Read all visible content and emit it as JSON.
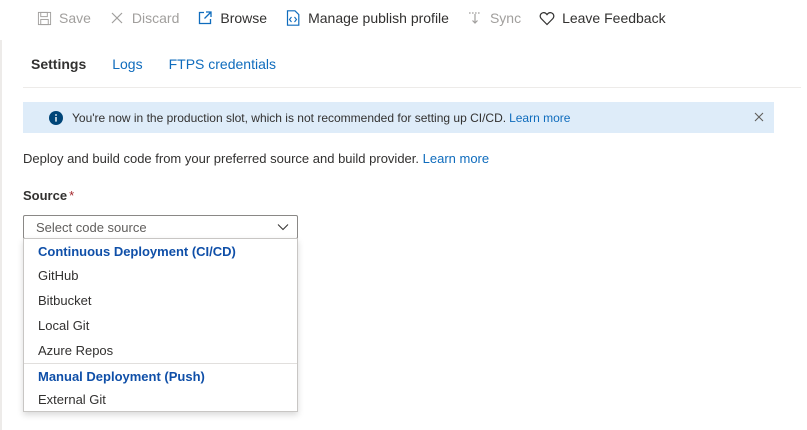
{
  "toolbar": {
    "save": "Save",
    "discard": "Discard",
    "browse": "Browse",
    "manage_publish_profile": "Manage publish profile",
    "sync": "Sync",
    "leave_feedback": "Leave Feedback"
  },
  "tabs": [
    {
      "label": "Settings",
      "active": true
    },
    {
      "label": "Logs",
      "active": false
    },
    {
      "label": "FTPS credentials",
      "active": false
    }
  ],
  "info_bar": {
    "message": "You're now in the production slot, which is not recommended for setting up CI/CD.",
    "link": "Learn more"
  },
  "description": {
    "text": "Deploy and build code from your preferred source and build provider.",
    "link": "Learn more"
  },
  "source": {
    "label": "Source",
    "required_marker": "*",
    "placeholder": "Select code source"
  },
  "dropdown": {
    "groups": [
      {
        "header": "Continuous Deployment (CI/CD)",
        "options": [
          "GitHub",
          "Bitbucket",
          "Local Git",
          "Azure Repos"
        ]
      },
      {
        "header": "Manual Deployment (Push)",
        "options": [
          "External Git"
        ]
      }
    ]
  },
  "colors": {
    "accent": "#0f6cbd",
    "info_background": "#deecf9",
    "disabled_text": "#a19f9d",
    "required": "#a4262c"
  },
  "icons": {
    "save": "save-icon",
    "discard": "close-icon",
    "browse": "open-external-icon",
    "manage_publish_profile": "file-code-icon",
    "sync": "sync-icon",
    "leave_feedback": "heart-icon",
    "info": "info-icon",
    "dismiss": "close-icon",
    "dropdown": "chevron-down-icon"
  }
}
